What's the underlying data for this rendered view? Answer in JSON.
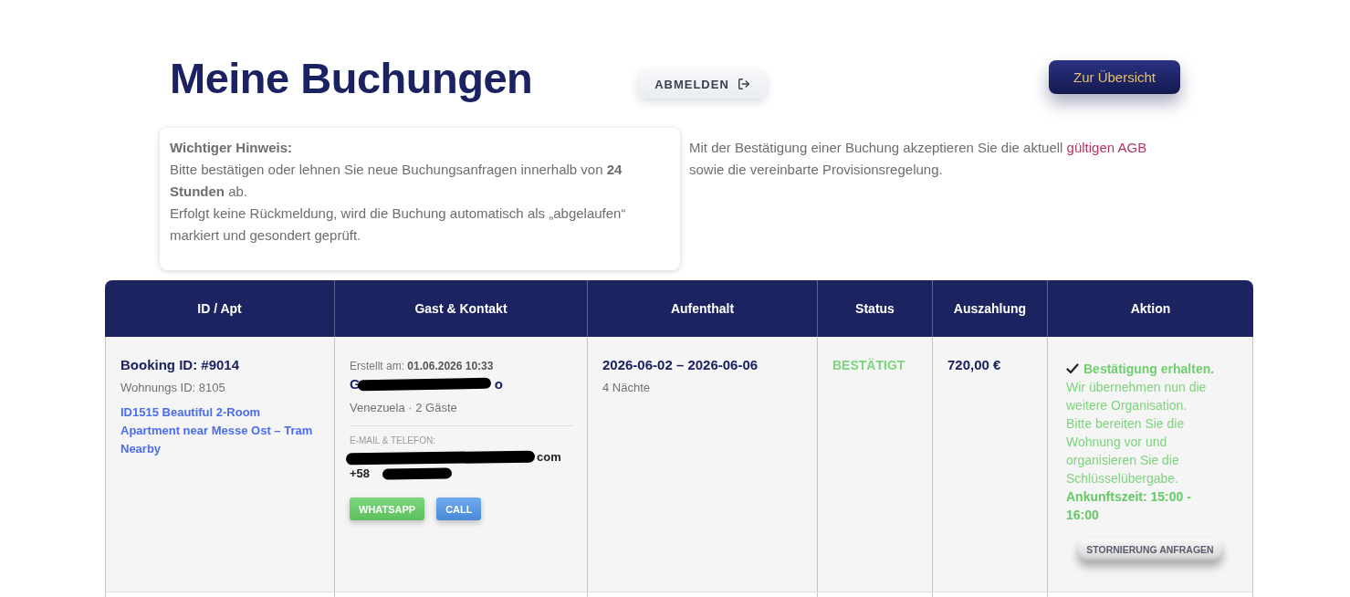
{
  "header": {
    "title": "Meine Buchungen",
    "logout_button": "ABMELDEN",
    "overview_button": "Zur Übersicht"
  },
  "notice": {
    "title": "Wichtiger Hinweis:",
    "paragraphs": [
      "Bitte bestätigen oder lehnen Sie neue Buchungsanfragen innerhalb von **24 Stunden** ab.",
      "Erfolgt keine Rückmeldung, wird die Buchung automatisch als „abgelaufen“ markiert und gesondert geprüft."
    ]
  },
  "terms_note": {
    "text_before": "Mit der Bestätigung einer Buchung akzeptieren Sie die aktuell",
    "link": "gültigen AGB",
    "text_after": "sowie die vereinbarte Provisionsregelung."
  },
  "table": {
    "columns": [
      "ID / Apt",
      "Gast & Kontakt",
      "Aufenthalt",
      "Status",
      "Auszahlung",
      "Aktion"
    ],
    "rows": [
      {
        "booking_id": "Booking ID: #9014",
        "apartment_id": "Wohnungs ID: 8105",
        "apartment_link": "ID1515 Beautiful 2-Room Apartment near Messe Ost – Tram Nearby",
        "guest": {
          "created": "Erstellt am: **01.06.2026 10:33**",
          "name_start": "G",
          "name_end": "o",
          "details": "Venezuela · 2 Gäste",
          "contact_label": "E-MAIL & TELEFON:",
          "email_end": "com",
          "phone_start": "+58",
          "buttons": [
            {
              "label": "WHATSAPP",
              "kind": "whatsapp"
            },
            {
              "label": "CALL",
              "kind": "call"
            }
          ]
        },
        "stay": {
          "dates": "2026-06-02 – 2026-06-06",
          "nights": "4 Nächte"
        },
        "status": {
          "label": "BESTÄTIGT",
          "kind": "confirmed"
        },
        "payout": "720,00 €",
        "action": {
          "heading": "Bestätigung erhalten.",
          "message": "Wir übernehmen nun die weitere Organisation. Bitte bereiten Sie die Wohnung vor und organisieren Sie die Schlüsselübergabe.",
          "arrival": "Ankunftszeit: 15:00 - 16:00",
          "button": "STORNIERUNG ANFRAGEN"
        }
      }
    ]
  }
}
